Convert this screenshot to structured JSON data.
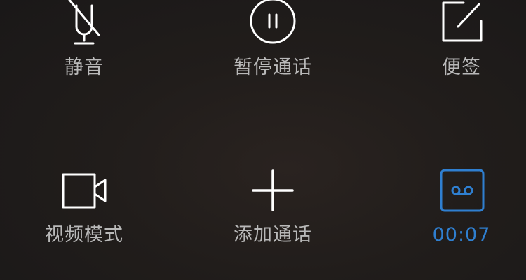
{
  "buttons": {
    "mute": {
      "label": "静音",
      "icon": "mic-off-icon"
    },
    "hold": {
      "label": "暂停通话",
      "icon": "pause-icon"
    },
    "notes": {
      "label": "便签",
      "icon": "note-edit-icon"
    },
    "video": {
      "label": "视频模式",
      "icon": "video-camera-icon"
    },
    "add_call": {
      "label": "添加通话",
      "icon": "plus-icon"
    },
    "record": {
      "label": "00:07",
      "icon": "voicemail-record-icon",
      "state": "active"
    }
  },
  "colors": {
    "icon": "#ffffff",
    "label": "#b9b9b9",
    "active": "#2f7fd0"
  }
}
